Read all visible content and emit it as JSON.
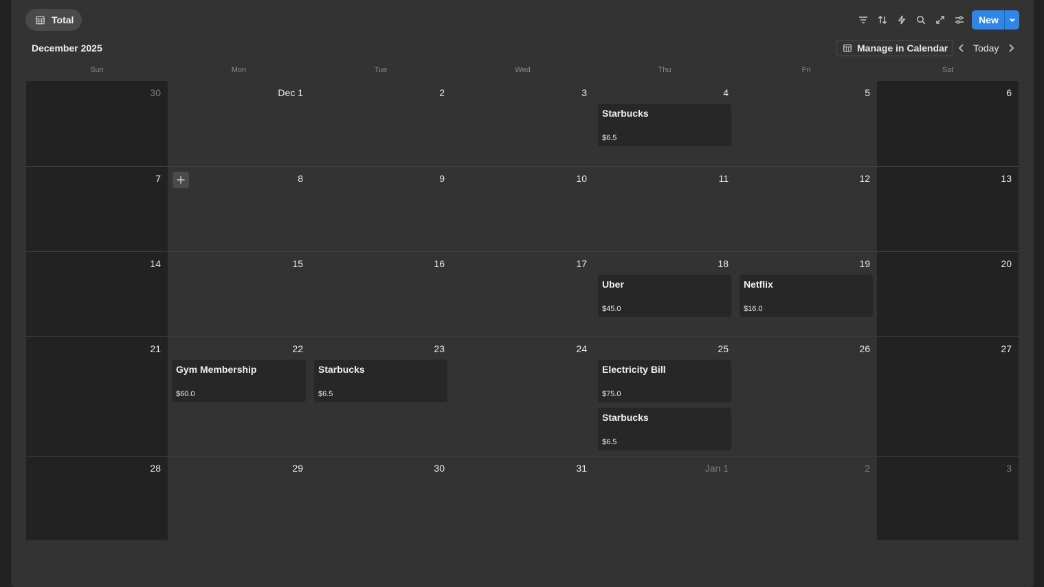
{
  "view_tab": {
    "label": "Total",
    "icon": "table-icon"
  },
  "toolbar": {
    "icons": [
      "filter-icon",
      "sort-icon",
      "lightning-icon",
      "search-icon",
      "expand-icon",
      "settings-icon"
    ],
    "new_label": "New"
  },
  "calendar": {
    "month_title": "December 2025",
    "manage_label": "Manage in Calendar",
    "today_label": "Today",
    "weekdays": [
      "Sun",
      "Mon",
      "Tue",
      "Wed",
      "Thu",
      "Fri",
      "Sat"
    ],
    "weeks": [
      [
        {
          "day": "30",
          "muted": true,
          "events": []
        },
        {
          "day": "Dec 1",
          "muted": false,
          "events": []
        },
        {
          "day": "2",
          "muted": false,
          "events": []
        },
        {
          "day": "3",
          "muted": false,
          "events": []
        },
        {
          "day": "4",
          "muted": false,
          "events": [
            {
              "name": "Starbucks",
              "amount": "$6.5"
            }
          ]
        },
        {
          "day": "5",
          "muted": false,
          "events": []
        },
        {
          "day": "6",
          "muted": false,
          "events": []
        }
      ],
      [
        {
          "day": "7",
          "muted": false,
          "events": []
        },
        {
          "day": "8",
          "muted": false,
          "events": []
        },
        {
          "day": "9",
          "muted": false,
          "events": []
        },
        {
          "day": "10",
          "muted": false,
          "events": []
        },
        {
          "day": "11",
          "muted": false,
          "events": []
        },
        {
          "day": "12",
          "muted": false,
          "events": []
        },
        {
          "day": "13",
          "muted": false,
          "events": []
        }
      ],
      [
        {
          "day": "14",
          "muted": false,
          "events": []
        },
        {
          "day": "15",
          "muted": false,
          "events": []
        },
        {
          "day": "16",
          "muted": false,
          "events": []
        },
        {
          "day": "17",
          "muted": false,
          "events": []
        },
        {
          "day": "18",
          "muted": false,
          "events": [
            {
              "name": "Uber",
              "amount": "$45.0"
            }
          ]
        },
        {
          "day": "19",
          "muted": false,
          "events": [
            {
              "name": "Netflix",
              "amount": "$16.0"
            }
          ]
        },
        {
          "day": "20",
          "muted": false,
          "events": []
        }
      ],
      [
        {
          "day": "21",
          "muted": false,
          "events": []
        },
        {
          "day": "22",
          "muted": false,
          "events": [
            {
              "name": "Gym Membership",
              "amount": "$60.0"
            }
          ]
        },
        {
          "day": "23",
          "muted": false,
          "events": [
            {
              "name": "Starbucks",
              "amount": "$6.5"
            }
          ]
        },
        {
          "day": "24",
          "muted": false,
          "events": []
        },
        {
          "day": "25",
          "muted": false,
          "events": [
            {
              "name": "Electricity Bill",
              "amount": "$75.0"
            },
            {
              "name": "Starbucks",
              "amount": "$6.5"
            }
          ]
        },
        {
          "day": "26",
          "muted": false,
          "events": []
        },
        {
          "day": "27",
          "muted": false,
          "events": []
        }
      ],
      [
        {
          "day": "28",
          "muted": false,
          "events": []
        },
        {
          "day": "29",
          "muted": false,
          "events": []
        },
        {
          "day": "30",
          "muted": false,
          "events": []
        },
        {
          "day": "31",
          "muted": false,
          "events": []
        },
        {
          "day": "Jan 1",
          "muted": true,
          "events": []
        },
        {
          "day": "2",
          "muted": true,
          "events": []
        },
        {
          "day": "3",
          "muted": true,
          "events": []
        }
      ]
    ]
  }
}
